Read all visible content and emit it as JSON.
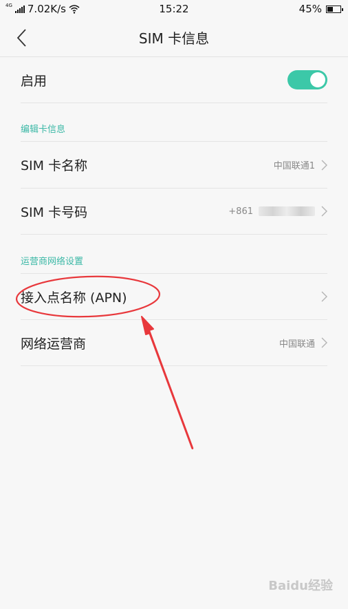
{
  "status_bar": {
    "network_type": "4G",
    "speed": "7.02K/s",
    "time": "15:22",
    "battery_percent": "45%",
    "battery_level": 0.45,
    "icons": [
      "signal-icon",
      "wifi-icon",
      "battery-icon"
    ]
  },
  "header": {
    "back_icon": "chevron-left-icon",
    "title": "SIM 卡信息"
  },
  "enable_row": {
    "label": "启用",
    "toggle_on": true,
    "toggle_color": "#3cc8a8"
  },
  "sections": [
    {
      "title": "编辑卡信息",
      "rows": [
        {
          "label": "SIM 卡名称",
          "value": "中国联通1"
        },
        {
          "label": "SIM 卡号码",
          "value": "+861"
        }
      ]
    },
    {
      "title": "运营商网络设置",
      "rows": [
        {
          "label": "接入点名称 (APN)",
          "value": ""
        },
        {
          "label": "网络运营商",
          "value": "中国联通"
        }
      ]
    }
  ],
  "accent_color": "#3bb8a6",
  "annotation_color": "#e8383c",
  "watermark": "Baidu经验"
}
